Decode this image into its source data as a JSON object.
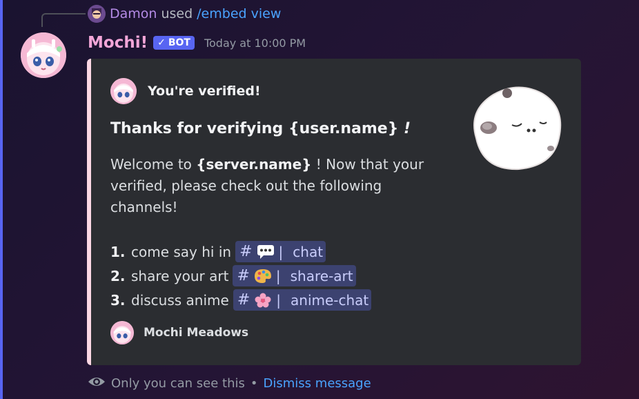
{
  "reply": {
    "user": "Damon",
    "action": "used",
    "command": "/embed view"
  },
  "message": {
    "author": "Mochi!",
    "badge": "BOT",
    "timestamp": "Today at 10:00 PM"
  },
  "embed": {
    "accent_color": "#fbd7e4",
    "author_name": "You're verified!",
    "title_prefix": "Thanks for verifying ",
    "title_var": "{user.name}",
    "title_suffix": " !",
    "desc_prefix": "Welcome to ",
    "desc_var": "{server.name}",
    "desc_suffix": " ! Now that your verified, please check out the following channels!",
    "list": [
      {
        "num": "1.",
        "text": "come say hi in",
        "channel_emoji": "speech-bubble-icon",
        "channel": "chat"
      },
      {
        "num": "2.",
        "text": "share your art",
        "channel_emoji": "palette-icon",
        "channel": "share-art"
      },
      {
        "num": "3.",
        "text": "discuss anime",
        "channel_emoji": "cherry-blossom-icon",
        "channel": "anime-chat"
      }
    ],
    "channel_hash": "#",
    "channel_sep": "|",
    "footer": "Mochi Meadows"
  },
  "ephemeral": {
    "text": "Only you can see this",
    "bullet": "•",
    "dismiss": "Dismiss message"
  }
}
